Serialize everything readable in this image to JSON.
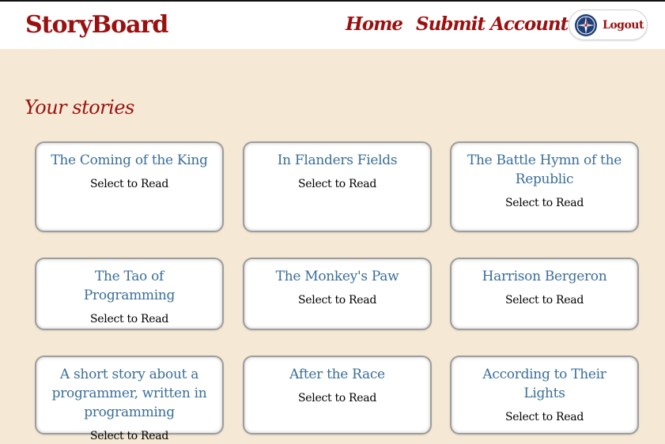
{
  "header": {
    "brand": "StoryBoard",
    "nav": {
      "home": "Home",
      "submit": "Submit",
      "account": "Account"
    },
    "logout_label": "Logout",
    "logout_icon": "compass-icon"
  },
  "main": {
    "section_title": "Your stories",
    "stories": [
      {
        "title": "The Coming of the King",
        "action": "Select to Read"
      },
      {
        "title": "In Flanders Fields",
        "action": "Select to Read"
      },
      {
        "title": "The Battle Hymn of the Republic",
        "action": "Select to Read"
      },
      {
        "title": "The Tao of Programming",
        "action": "Select to Read"
      },
      {
        "title": "The Monkey's Paw",
        "action": "Select to Read"
      },
      {
        "title": "Harrison Bergeron",
        "action": "Select to Read"
      },
      {
        "title": "A short story about a programmer, written in programming",
        "action": "Select to Read"
      },
      {
        "title": "After the Race",
        "action": "Select to Read"
      },
      {
        "title": "According to Their Lights",
        "action": "Select to Read"
      }
    ]
  },
  "colors": {
    "brand": "#9a1010",
    "page_background": "#f5e9d5",
    "card_title": "#3a6e98"
  }
}
